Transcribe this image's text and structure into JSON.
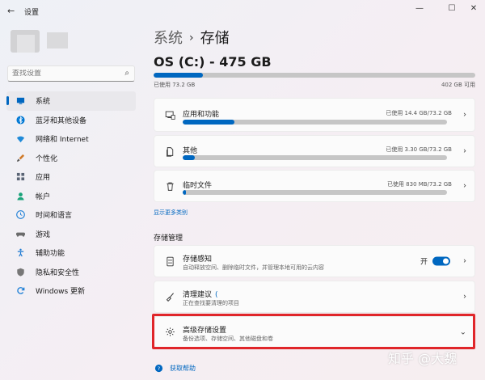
{
  "window": {
    "back_glyph": "←",
    "title": "设置",
    "minimize_glyph": "—",
    "maximize_glyph": "☐",
    "close_glyph": "✕"
  },
  "search": {
    "placeholder": "查找设置"
  },
  "sidebar": {
    "items": [
      {
        "label": "系统",
        "icon": "monitor-icon",
        "color": "#0067c0",
        "active": true
      },
      {
        "label": "蓝牙和其他设备",
        "icon": "bluetooth-icon",
        "color": "#0078d4"
      },
      {
        "label": "网络和 Internet",
        "icon": "wifi-icon",
        "color": "#1f8ad8"
      },
      {
        "label": "个性化",
        "icon": "brush-icon",
        "color": "#d07a2a"
      },
      {
        "label": "应用",
        "icon": "apps-icon",
        "color": "#5a6475"
      },
      {
        "label": "帐户",
        "icon": "person-icon",
        "color": "#1aa37a"
      },
      {
        "label": "时间和语言",
        "icon": "globe-clock-icon",
        "color": "#1d7fd6"
      },
      {
        "label": "游戏",
        "icon": "gamepad-icon",
        "color": "#6b6b6b"
      },
      {
        "label": "辅助功能",
        "icon": "accessibility-icon",
        "color": "#1d79d2"
      },
      {
        "label": "隐私和安全性",
        "icon": "shield-icon",
        "color": "#777777"
      },
      {
        "label": "Windows 更新",
        "icon": "update-icon",
        "color": "#1d7fd6"
      }
    ]
  },
  "breadcrumb": {
    "parent": "系统",
    "separator": "›",
    "current": "存储"
  },
  "drive": {
    "title": "OS (C:) - 475 GB",
    "used_label": "已使用 73.2 GB",
    "free_label": "402 GB 可用",
    "used_fraction": 0.154
  },
  "categories": [
    {
      "label": "应用和功能",
      "value": "已使用 14.4 GB/73.2 GB",
      "fraction": 0.197,
      "icon": "apps-features-icon"
    },
    {
      "label": "其他",
      "value": "已使用 3.30 GB/73.2 GB",
      "fraction": 0.045,
      "icon": "other-files-icon"
    },
    {
      "label": "临时文件",
      "value": "已使用 830 MB/73.2 GB",
      "fraction": 0.011,
      "icon": "trash-icon"
    }
  ],
  "show_more": "显示更多类别",
  "management": {
    "title": "存储管理",
    "sense": {
      "title": "存储感知",
      "subtitle": "自动释放空间、删除临时文件，并管理本地可用的云内容",
      "toggle_label": "开",
      "toggle_on": true
    },
    "cleanup": {
      "title": "清理建议",
      "loading": "(",
      "subtitle": "正在查找要清理的项目"
    },
    "advanced": {
      "title": "高级存储设置",
      "subtitle": "备份选项、存储空间、其他磁盘和卷"
    }
  },
  "chevrons": {
    "right": "›",
    "down": "⌄"
  },
  "help": {
    "label": "获取帮助"
  },
  "watermark": "知乎 @大魏",
  "colors": {
    "accent": "#0067c0",
    "highlight_border": "#e0262a"
  }
}
